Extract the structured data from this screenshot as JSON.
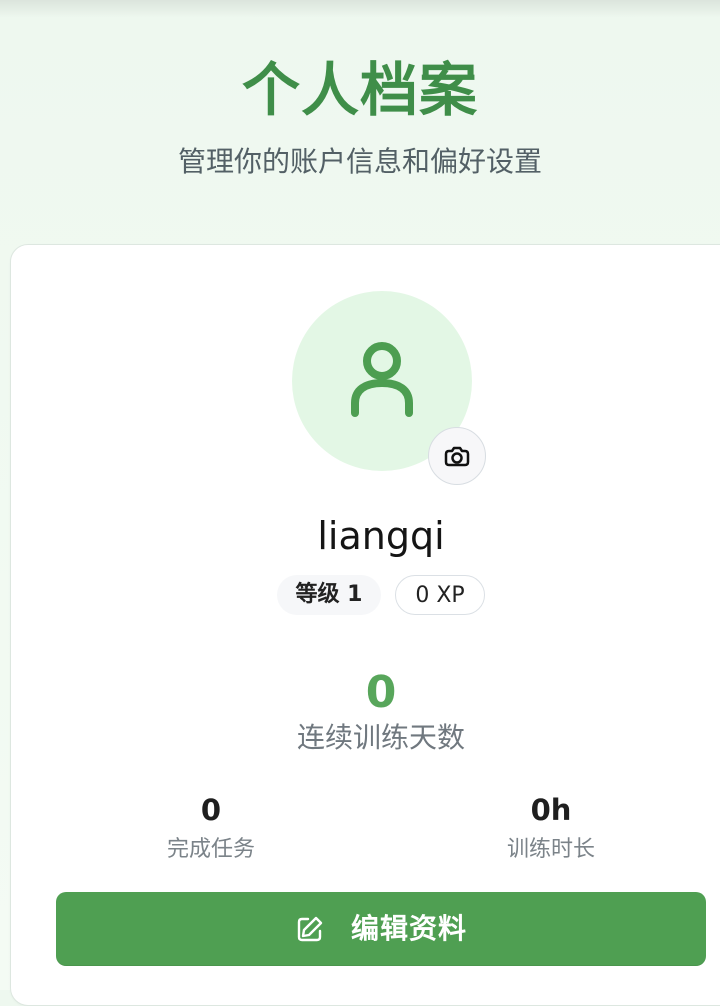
{
  "header": {
    "title": "个人档案",
    "subtitle": "管理你的账户信息和偏好设置"
  },
  "profile": {
    "avatar_icon": "user-icon",
    "camera_icon": "camera-icon",
    "username": "liangqi",
    "level_badge": "等级 1",
    "xp_badge": "0 XP",
    "streak_value": "0",
    "streak_label": "连续训练天数",
    "stats": [
      {
        "value": "0",
        "label": "完成任务"
      },
      {
        "value": "0h",
        "label": "训练时长"
      }
    ],
    "edit_icon": "edit-icon",
    "edit_button": "编辑资料"
  },
  "colors": {
    "brand_green": "#4f9f52",
    "title_green": "#3f8e49",
    "avatar_background": "#e3f7e5"
  }
}
